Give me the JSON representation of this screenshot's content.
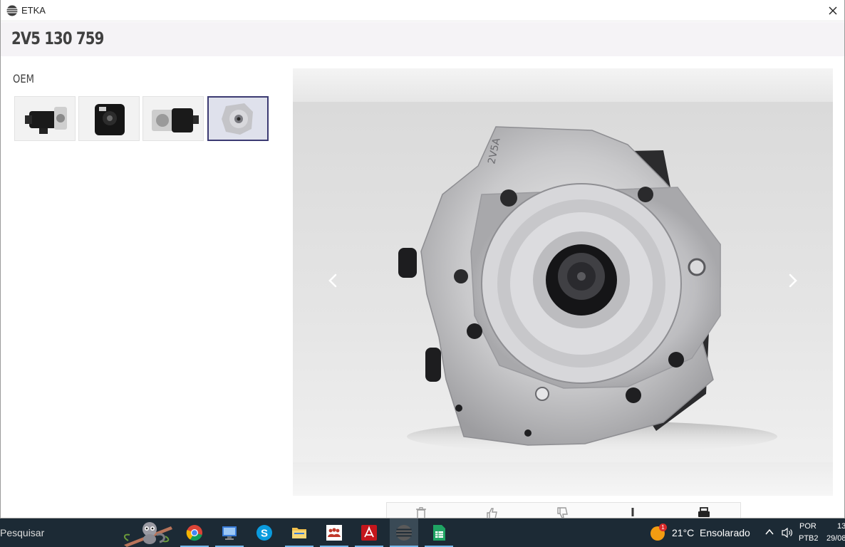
{
  "window": {
    "title": "ETKA"
  },
  "header": {
    "part_number": "2V5 130 759"
  },
  "gallery": {
    "section_label": "OEM",
    "thumbnails": [
      {
        "name": "thumbnail-1",
        "selected": false
      },
      {
        "name": "thumbnail-2",
        "selected": false
      },
      {
        "name": "thumbnail-3",
        "selected": false
      },
      {
        "name": "thumbnail-4",
        "selected": true
      }
    ]
  },
  "viewer": {
    "prev_icon": "chevron-left-icon",
    "next_icon": "chevron-right-icon",
    "embossed_text": "2V5A"
  },
  "toolbar": {
    "buttons": [
      "trash-icon",
      "thumbs-up-icon",
      "thumbs-down-icon",
      "exclamation-icon",
      "print-icon"
    ]
  },
  "taskbar": {
    "search_text": "Pesquisar",
    "apps": [
      "chrome-icon",
      "remote-desktop-icon",
      "skype-icon",
      "file-explorer-icon",
      "teams-icon",
      "acrobat-icon",
      "etka-icon",
      "sheets-icon"
    ],
    "weather": {
      "badge": "1",
      "temperature": "21°C",
      "condition": "Ensolarado"
    },
    "language": {
      "line1": "POR",
      "line2": "PTB2"
    },
    "clock": {
      "time": "13",
      "date": "29/08"
    }
  },
  "colors": {
    "taskbar": "#1c2a35",
    "selected_thumb_border": "#3b3a72",
    "header_bg": "#f5f3f6",
    "taskbar_underline": "#76b9ed"
  }
}
